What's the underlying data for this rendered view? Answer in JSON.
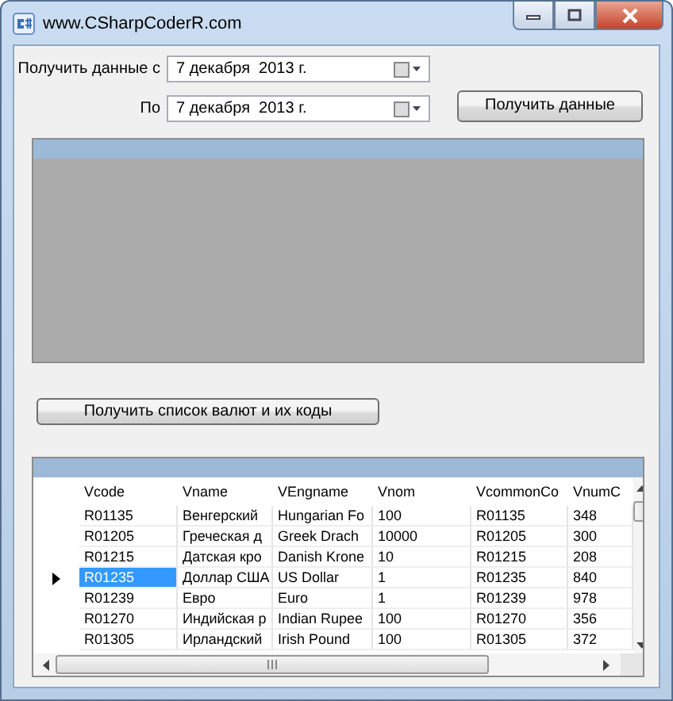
{
  "window": {
    "title": "www.CSharpCoderR.com"
  },
  "date_from": {
    "label": "Получить данные с",
    "value": "7 декабря  2013 г."
  },
  "date_to": {
    "label": "По",
    "value": "7 декабря  2013 г."
  },
  "get_data_button": "Получить данные",
  "currency_list_button": "Получить список валют и их коды",
  "table": {
    "columns": [
      "Vcode",
      "Vname",
      "VEngname",
      "Vnom",
      "VcommonCo",
      "VnumC"
    ],
    "rows": [
      {
        "selected": false,
        "cells": [
          "R01135",
          "Венгерский",
          "Hungarian Fo",
          "100",
          "R01135",
          "348"
        ]
      },
      {
        "selected": false,
        "cells": [
          "R01205",
          "Греческая д",
          "Greek Drach",
          "10000",
          "R01205",
          "300"
        ]
      },
      {
        "selected": false,
        "cells": [
          "R01215",
          "Датская кро",
          "Danish Krone",
          "10",
          "R01215",
          "208"
        ]
      },
      {
        "selected": true,
        "cells": [
          "R01235",
          "Доллар США",
          "US Dollar",
          "1",
          "R01235",
          "840"
        ]
      },
      {
        "selected": false,
        "cells": [
          "R01239",
          "Евро",
          "Euro",
          "1",
          "R01239",
          "978"
        ]
      },
      {
        "selected": false,
        "cells": [
          "R01270",
          "Индийская р",
          "Indian Rupee",
          "100",
          "R01270",
          "356"
        ]
      },
      {
        "selected": false,
        "cells": [
          "R01305",
          "Ирландский",
          "Irish Pound",
          "100",
          "R01305",
          "372"
        ]
      }
    ]
  }
}
